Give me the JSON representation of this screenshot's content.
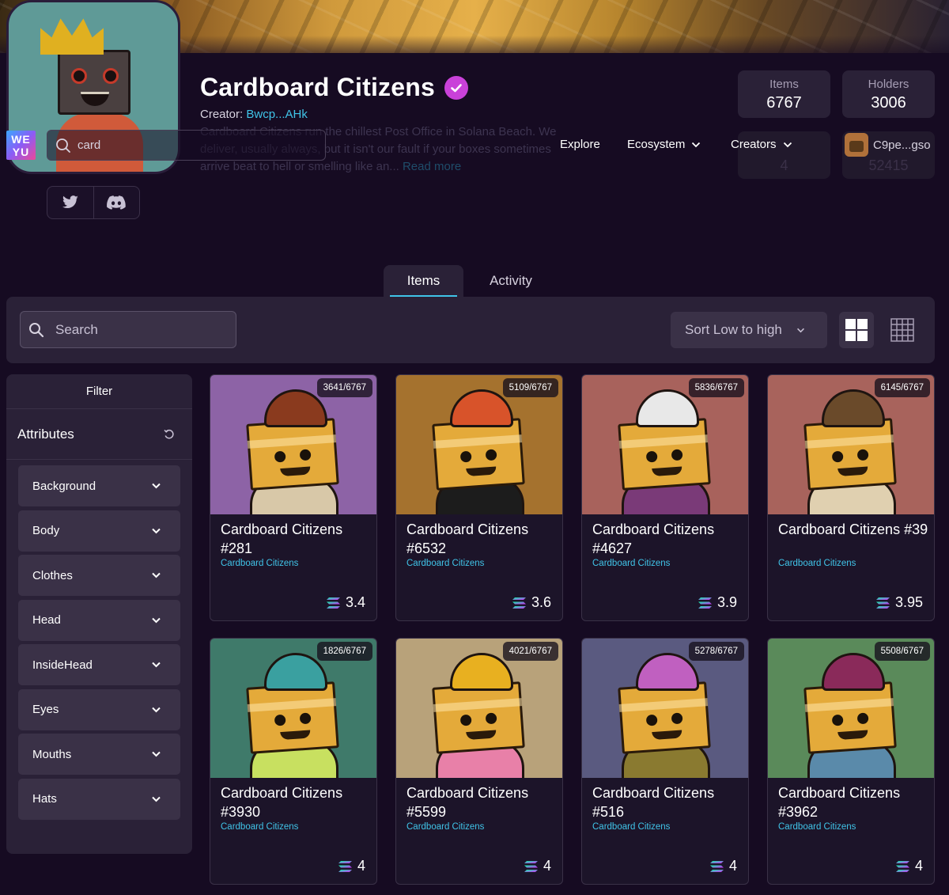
{
  "header": {
    "logo_text": "WE YU",
    "search_value": "card",
    "nav": [
      {
        "label": "Explore"
      },
      {
        "label": "Ecosystem"
      },
      {
        "label": "Creators"
      }
    ],
    "user": "C9pe...gso"
  },
  "collection": {
    "title": "Cardboard Citizens",
    "creator_label": "Creator:",
    "creator_address": "Bwcp...AHk",
    "description": "Cardboard Citizens run the chillest Post Office in Solana Beach. We deliver, usually always, but it isn't our fault if your boxes sometimes arrive beat to hell or smelling like an...",
    "read_more": "Read more",
    "stats": [
      {
        "label": "Items",
        "value": "6767"
      },
      {
        "label": "Holders",
        "value": "3006"
      }
    ],
    "stats_hidden": [
      "4",
      "52415"
    ]
  },
  "tabs": [
    {
      "label": "Items",
      "active": true
    },
    {
      "label": "Activity",
      "active": false
    }
  ],
  "toolbar": {
    "search_placeholder": "Search",
    "sort_label": "Sort Low to high"
  },
  "filter": {
    "title": "Filter",
    "attributes_title": "Attributes",
    "attributes": [
      "Background",
      "Body",
      "Clothes",
      "Head",
      "InsideHead",
      "Eyes",
      "Mouths",
      "Hats"
    ]
  },
  "cards": [
    {
      "rank": "3641/6767",
      "name": "Cardboard Citizens #281",
      "collection": "Cardboard Citizens",
      "price": "3.4",
      "bg": "#8d63a6",
      "hat": "#8a3a1e",
      "torso": "#d8c8a8"
    },
    {
      "rank": "5109/6767",
      "name": "Cardboard Citizens #6532",
      "collection": "Cardboard Citizens",
      "price": "3.6",
      "bg": "#a5722e",
      "hat": "#d8532a",
      "torso": "#1c1c1c"
    },
    {
      "rank": "5836/6767",
      "name": "Cardboard Citizens #4627",
      "collection": "Cardboard Citizens",
      "price": "3.9",
      "bg": "#a8625c",
      "hat": "#e8e8e8",
      "torso": "#7a3a78"
    },
    {
      "rank": "6145/6767",
      "name": "Cardboard Citizens #39",
      "collection": "Cardboard Citizens",
      "price": "3.95",
      "bg": "#a8635c",
      "hat": "#6a4a2a",
      "torso": "#e0d0b0"
    },
    {
      "rank": "1826/6767",
      "name": "Cardboard Citizens #3930",
      "collection": "Cardboard Citizens",
      "price": "4",
      "bg": "#3f7a6a",
      "hat": "#3aa0a0",
      "torso": "#c8e060"
    },
    {
      "rank": "4021/6767",
      "name": "Cardboard Citizens #5599",
      "collection": "Cardboard Citizens",
      "price": "4",
      "bg": "#b8a27a",
      "hat": "#e8b020",
      "torso": "#e880a8"
    },
    {
      "rank": "5278/6767",
      "name": "Cardboard Citizens #516",
      "collection": "Cardboard Citizens",
      "price": "4",
      "bg": "#5a5a80",
      "hat": "#c060c0",
      "torso": "#8a7a30"
    },
    {
      "rank": "5508/6767",
      "name": "Cardboard Citizens #3962",
      "collection": "Cardboard Citizens",
      "price": "4",
      "bg": "#5a8a5a",
      "hat": "#8a2a5a",
      "torso": "#5a8aaa"
    }
  ],
  "colors": {
    "accent_cyan": "#40c4e8",
    "verified": "#c941d9",
    "panel": "#2a2137",
    "background": "#160b22"
  },
  "icons": {
    "search": "search-icon",
    "verified": "verified-check-icon",
    "twitter": "twitter-icon",
    "discord": "discord-icon",
    "chevron": "chevron-down-icon",
    "reset": "reset-icon",
    "grid_large": "grid-large-icon",
    "grid_small": "grid-small-icon",
    "solana": "solana-icon"
  }
}
